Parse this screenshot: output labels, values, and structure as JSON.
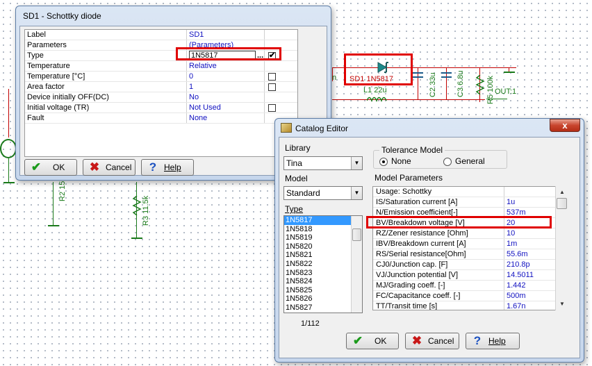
{
  "schematic": {
    "diode_label": "SD1 1N5817",
    "inductor_label": "L1 22u",
    "c2_label": "C2 33u",
    "c3_label": "C3 6.8u",
    "r5_label": "R5 100k",
    "out_label": "OUT:1",
    "r2_label": "R2 15",
    "r3_label": "R3 11.5k",
    "n_label": "n"
  },
  "props_dialog": {
    "title": "SD1 - Schottky diode",
    "rows": [
      {
        "name": "Label",
        "value": "SD1"
      },
      {
        "name": "Parameters",
        "value": "(Parameters)"
      },
      {
        "name": "Type",
        "value": "1N5817"
      },
      {
        "name": "Temperature",
        "value": "Relative"
      },
      {
        "name": "Temperature [°C]",
        "value": "0"
      },
      {
        "name": "Area factor",
        "value": "1"
      },
      {
        "name": "Device initially OFF(DC)",
        "value": "No"
      },
      {
        "name": "Initial voltage (TR)",
        "value": "Not Used"
      },
      {
        "name": "Fault",
        "value": "None"
      }
    ],
    "ok_label": "OK",
    "cancel_label": "Cancel",
    "help_label": "Help",
    "type_dots": "..."
  },
  "catalog": {
    "title": "Catalog Editor",
    "close": "x",
    "library_label": "Library",
    "library_value": "Tina",
    "model_label": "Model",
    "model_value": "Standard",
    "type_label": "Type",
    "types": [
      "1N5817",
      "1N5818",
      "1N5819",
      "1N5820",
      "1N5821",
      "1N5822",
      "1N5823",
      "1N5824",
      "1N5825",
      "1N5826",
      "1N5827"
    ],
    "selected_type": "1N5817",
    "counter": "1/112",
    "tolerance_label": "Tolerance Model",
    "tol_none": "None",
    "tol_general": "General",
    "model_params_label": "Model Parameters",
    "params": [
      {
        "name": "Usage: Schottky",
        "value": ""
      },
      {
        "name": "IS/Saturation current [A]",
        "value": "1u"
      },
      {
        "name": "N/Emission coefficient[-]",
        "value": "537m"
      },
      {
        "name": "BV/Breakdown voltage  [V]",
        "value": "20"
      },
      {
        "name": "RZ/Zener resistance [Ohm]",
        "value": "10"
      },
      {
        "name": "IBV/Breakdown current [A]",
        "value": "1m"
      },
      {
        "name": "RS/Serial resistance[Ohm]",
        "value": "55.6m"
      },
      {
        "name": "CJ0/Junction cap.      [F]",
        "value": "210.8p"
      },
      {
        "name": "VJ/Junction potential [V]",
        "value": "14.5011"
      },
      {
        "name": "MJ/Grading coeff.       [-]",
        "value": "1.442"
      },
      {
        "name": "FC/Capacitance coeff. [-]",
        "value": "500m"
      },
      {
        "name": "TT/Transit time         [s]",
        "value": "1.67n"
      }
    ],
    "ok_label": "OK",
    "cancel_label": "Cancel",
    "help_label": "Help"
  }
}
